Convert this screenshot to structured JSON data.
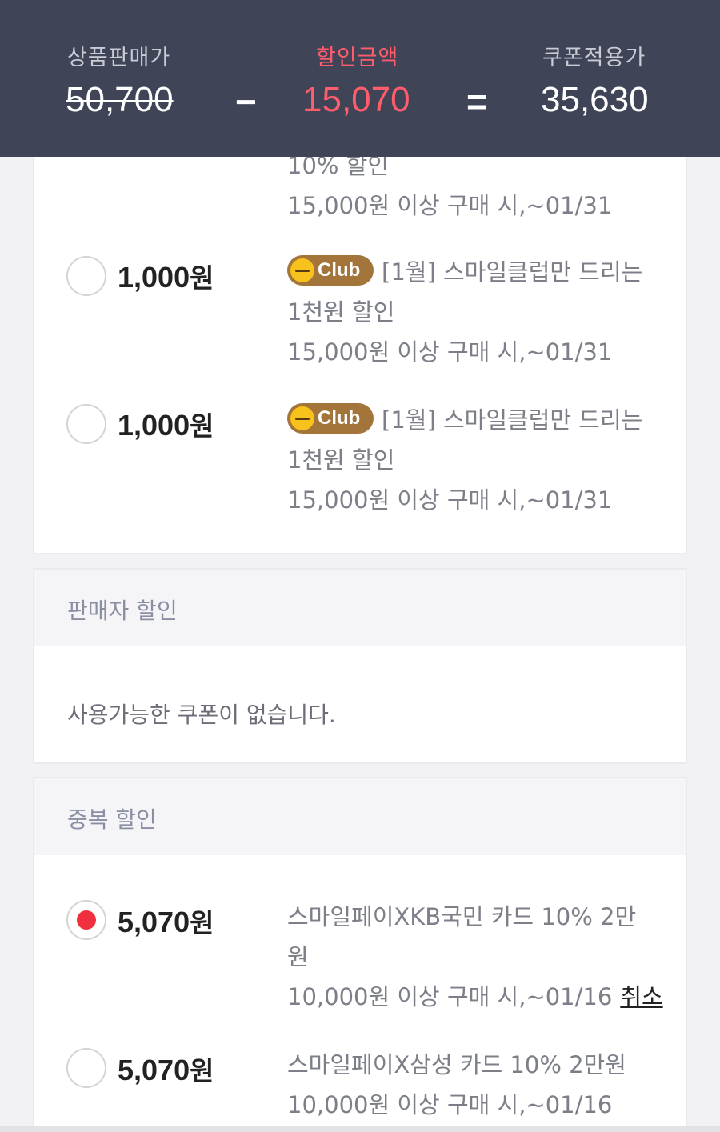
{
  "summary": {
    "original_label": "상품판매가",
    "original_price": "50,700",
    "minus": "−",
    "discount_label": "할인금액",
    "discount_amount": "15,070",
    "equals": "=",
    "final_label": "쿠폰적용가",
    "final_price": "35,630",
    "discount_color": "#ff5d6c",
    "header_bg": "#3f4457"
  },
  "main_coupons": {
    "partial_item": {
      "title_tail": "10% 할인",
      "condition": "15,000원 이상 구매 시,~01/31"
    },
    "items": [
      {
        "amount": "1,000",
        "unit": "원",
        "badge": "Club",
        "title_line1": "[1월] 스마일클럽만 드리는",
        "title_line2": "1천원 할인",
        "condition": "15,000원 이상 구매 시,~01/31",
        "selected": false
      },
      {
        "amount": "1,000",
        "unit": "원",
        "badge": "Club",
        "title_line1": "[1월] 스마일클럽만 드리는",
        "title_line2": "1천원 할인",
        "condition": "15,000원 이상 구매 시,~01/31",
        "selected": false
      }
    ]
  },
  "seller_discount": {
    "title": "판매자 할인",
    "empty_message": "사용가능한 쿠폰이 없습니다."
  },
  "duplicate_discount": {
    "title": "중복 할인",
    "items": [
      {
        "amount": "5,070",
        "unit": "원",
        "title_line1": "스마일페이XKB국민 카드 10% 2만",
        "title_line2": "원",
        "condition": "10,000원 이상 구매 시,~01/16",
        "cancel_label": "취소",
        "selected": true
      },
      {
        "amount": "5,070",
        "unit": "원",
        "title_line1": "스마일페이X삼성 카드 10% 2만원",
        "condition": "10,000원 이상 구매 시,~01/16",
        "selected": false
      }
    ]
  }
}
